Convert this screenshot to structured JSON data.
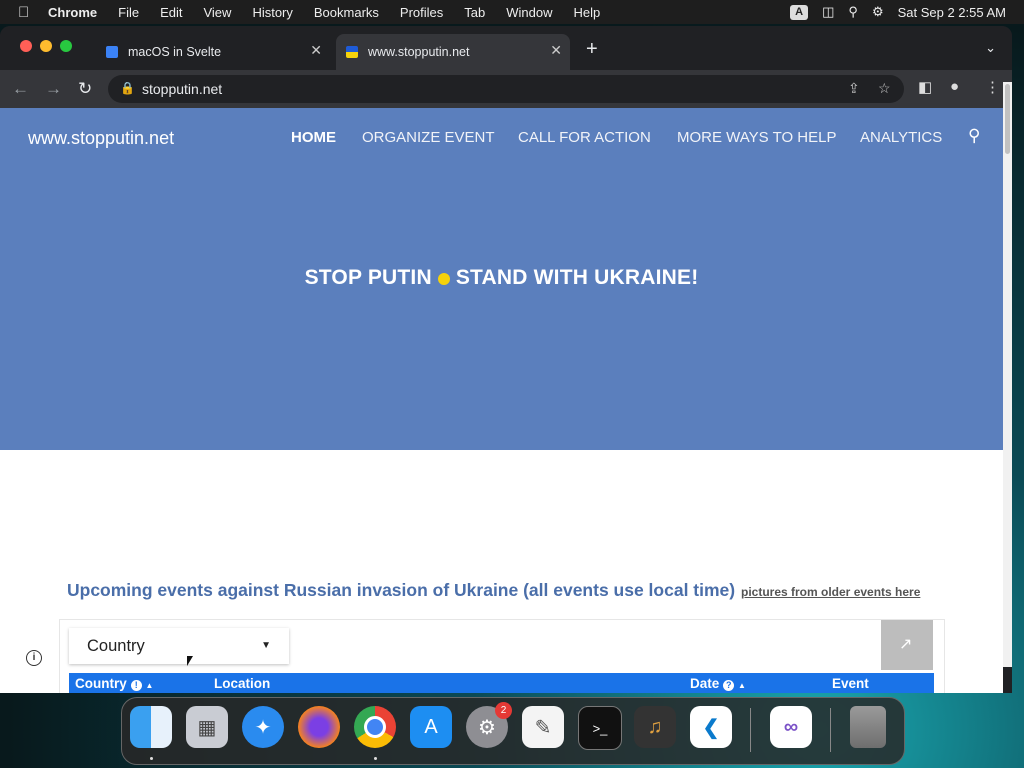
{
  "menubar": {
    "app_name": "Chrome",
    "items": [
      "File",
      "Edit",
      "View",
      "History",
      "Bookmarks",
      "Profiles",
      "Tab",
      "Window",
      "Help"
    ],
    "input_indicator": "A",
    "datetime": "Sat Sep 2  2:55 AM"
  },
  "browser": {
    "tabs": [
      {
        "title": "macOS in Svelte",
        "active": false
      },
      {
        "title": "www.stopputin.net",
        "active": true
      }
    ],
    "url": "stopputin.net"
  },
  "page": {
    "site_name": "www.stopputin.net",
    "nav": [
      "HOME",
      "ORGANIZE EVENT",
      "CALL FOR ACTION",
      "MORE WAYS TO HELP",
      "ANALYTICS"
    ],
    "headline_left": "STOP PUTIN",
    "headline_right": "STAND WITH UKRAINE!",
    "section_title": "Upcoming events against Russian invasion of Ukraine (all events use local time)",
    "older_link": "pictures from older events here",
    "country_select": "Country",
    "table_headers": {
      "country": "Country",
      "location": "Location",
      "date": "Date",
      "event": "Event"
    }
  },
  "dock": {
    "apps": [
      "Finder",
      "Launchpad",
      "Safari",
      "Firefox",
      "Chrome",
      "App Store",
      "System Preferences",
      "TextEdit",
      "Terminal",
      "GarageBand",
      "VS Code",
      "Visual Studio",
      "Trash"
    ],
    "system_preferences_badge": "2"
  },
  "colors": {
    "hero": "#5b7fbd",
    "table_header": "#1a73e8",
    "title_blue": "#4a6ea9",
    "ukraine_yellow": "#f5d20b"
  }
}
